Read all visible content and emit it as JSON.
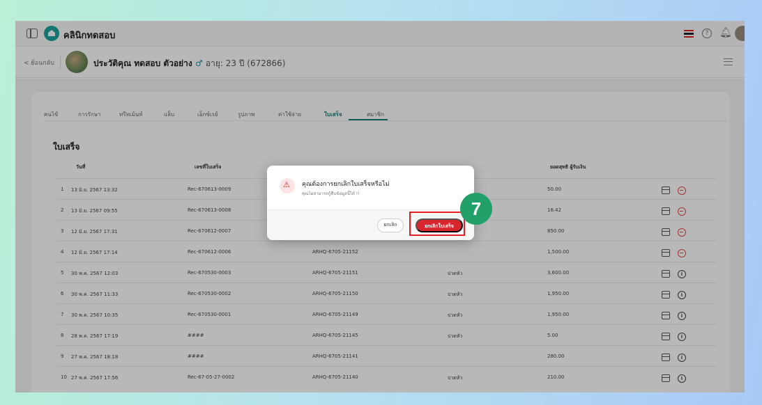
{
  "header": {
    "app_title": "คลินิกทดสอบ"
  },
  "patient": {
    "back_label": "< ย้อนกลับ",
    "title": "ประวัติคุณ ทดสอบ ตัวอย่าง",
    "gender_symbol": "♂",
    "meta": "อายุ: 23 ปี (672866)"
  },
  "tabs": [
    {
      "label": "คนไข้"
    },
    {
      "label": "การรักษา"
    },
    {
      "label": "ทรีทเม้นท์"
    },
    {
      "label": "แล็บ"
    },
    {
      "label": "เอ็กซ์เรย์"
    },
    {
      "label": "รูปภาพ"
    },
    {
      "label": "ค่าใช้จ่าย"
    },
    {
      "label": "ใบเสร็จ"
    },
    {
      "label": "สมาชิก"
    }
  ],
  "section_title": "ใบเสร็จ",
  "table": {
    "headers": {
      "date": "วันที่",
      "receipt": "เลขที่ใบเสร็จ",
      "amount": "ยอดสุทธิ ผู้รับเงิน"
    },
    "rows": [
      {
        "no": "1",
        "date": "13 มิ.ย. 2567 13:32",
        "receipt": "Rec-670613-0009",
        "invoice": "",
        "status": "",
        "amount": "50.00",
        "action": "cancel"
      },
      {
        "no": "2",
        "date": "13 มิ.ย. 2567 09:55",
        "receipt": "Rec-670613-0008",
        "invoice": "",
        "status": "",
        "amount": "16.42",
        "action": "cancel"
      },
      {
        "no": "3",
        "date": "12 มิ.ย. 2567 17:31",
        "receipt": "Rec-670612-0007",
        "invoice": "",
        "status": "",
        "amount": "850.00",
        "action": "cancel"
      },
      {
        "no": "4",
        "date": "12 มิ.ย. 2567 17:14",
        "receipt": "Rec-670612-0006",
        "invoice": "ARHQ-6705-21152",
        "status": "",
        "amount": "1,500.00",
        "action": "cancel"
      },
      {
        "no": "5",
        "date": "30 พ.ค. 2567 12:03",
        "receipt": "Rec-670530-0003",
        "invoice": "ARHQ-6705-21151",
        "status": "ปวดหัว",
        "amount": "3,600.00",
        "action": "info"
      },
      {
        "no": "6",
        "date": "30 พ.ค. 2567 11:33",
        "receipt": "Rec-670530-0002",
        "invoice": "ARHQ-6705-21150",
        "status": "ปวดหัว",
        "amount": "1,950.00",
        "action": "info"
      },
      {
        "no": "7",
        "date": "30 พ.ค. 2567 10:35",
        "receipt": "Rec-670530-0001",
        "invoice": "ARHQ-6705-21149",
        "status": "ปวดหัว",
        "amount": "1,950.00",
        "action": "info"
      },
      {
        "no": "8",
        "date": "28 พ.ค. 2567 17:19",
        "receipt": "####",
        "invoice": "ARHQ-6705-21145",
        "status": "ปวดหัว",
        "amount": "5.00",
        "action": "info"
      },
      {
        "no": "9",
        "date": "27 พ.ค. 2567 18:18",
        "receipt": "####",
        "invoice": "ARHQ-6705-21141",
        "status": "",
        "amount": "280.00",
        "action": "info"
      },
      {
        "no": "10",
        "date": "27 พ.ค. 2567 17:56",
        "receipt": "Rec-67-05-27-0002",
        "invoice": "ARHQ-6705-21140",
        "status": "ปวดหัว",
        "amount": "210.00",
        "action": "info"
      }
    ]
  },
  "modal": {
    "title": "คุณต้องการยกเลิกใบเสร็จหรือไม่",
    "subtitle": "คุณไม่สามารถกู้คืนข้อมูลนี้ได้ !!",
    "cancel_label": "ยกเลิก",
    "confirm_label": "ยกเลิกใบเสร็จ"
  },
  "step_badge": "7",
  "colors": {
    "accent": "#147e78",
    "danger": "#d7262e",
    "badge": "#22a069"
  }
}
